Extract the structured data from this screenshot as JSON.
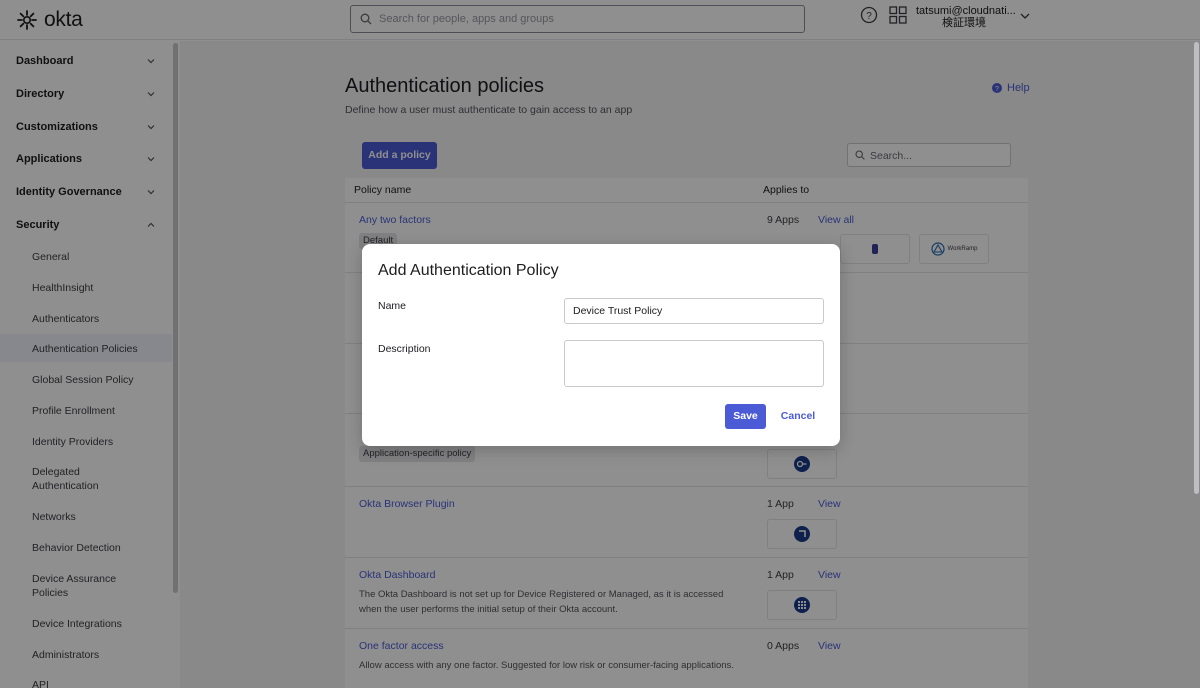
{
  "header": {
    "logo_text": "okta",
    "search_placeholder": "Search for people, apps and groups",
    "user_name": "tatsumi@cloudnati...",
    "user_org": "検証環境"
  },
  "sidebar": {
    "sections": [
      {
        "label": "Dashboard",
        "expanded": false
      },
      {
        "label": "Directory",
        "expanded": false
      },
      {
        "label": "Customizations",
        "expanded": false
      },
      {
        "label": "Applications",
        "expanded": false
      },
      {
        "label": "Identity Governance",
        "expanded": false
      },
      {
        "label": "Security",
        "expanded": true
      }
    ],
    "items": [
      {
        "label": "General"
      },
      {
        "label": "HealthInsight"
      },
      {
        "label": "Authenticators"
      },
      {
        "label": "Authentication Policies",
        "active": true
      },
      {
        "label": "Global Session Policy"
      },
      {
        "label": "Profile Enrollment"
      },
      {
        "label": "Identity Providers"
      },
      {
        "label": "Delegated Authentication"
      },
      {
        "label": "Networks"
      },
      {
        "label": "Behavior Detection"
      },
      {
        "label": "Device Assurance Policies"
      },
      {
        "label": "Device Integrations"
      },
      {
        "label": "Administrators"
      },
      {
        "label": "API"
      }
    ]
  },
  "main": {
    "title": "Authentication policies",
    "subtitle": "Define how a user must authenticate to gain access to an app",
    "help_label": "Help",
    "add_policy_label": "Add a policy",
    "search_placeholder": "Search...",
    "columns": [
      "Policy name",
      "Applies to"
    ],
    "policies": [
      {
        "name": "Any two factors",
        "tag": "Default",
        "apps": "9 Apps",
        "view": "View all",
        "app_tiles": [
          "",
          "",
          "WorkRamp"
        ]
      },
      {
        "name": "",
        "tag": "Application-specific policy",
        "apps": "",
        "view": ""
      },
      {
        "name": "Okta Browser Plugin",
        "apps": "1 App",
        "view": "View"
      },
      {
        "name": "Okta Dashboard",
        "description": "The Okta Dashboard is not set up for Device Registered or Managed, as it is accessed when the user performs the initial setup of their Okta account.",
        "apps": "1 App",
        "view": "View"
      },
      {
        "name": "One factor access",
        "description": "Allow access with any one factor. Suggested for low risk or consumer-facing applications.",
        "apps": "0 Apps",
        "view": "View"
      }
    ]
  },
  "modal": {
    "title": "Add Authentication Policy",
    "name_label": "Name",
    "name_value": "Device Trust Policy",
    "description_label": "Description",
    "description_value": "",
    "save_label": "Save",
    "cancel_label": "Cancel"
  },
  "colors": {
    "primary": "#4b5bd6",
    "overlay": "rgba(0,0,0,0.44)"
  }
}
